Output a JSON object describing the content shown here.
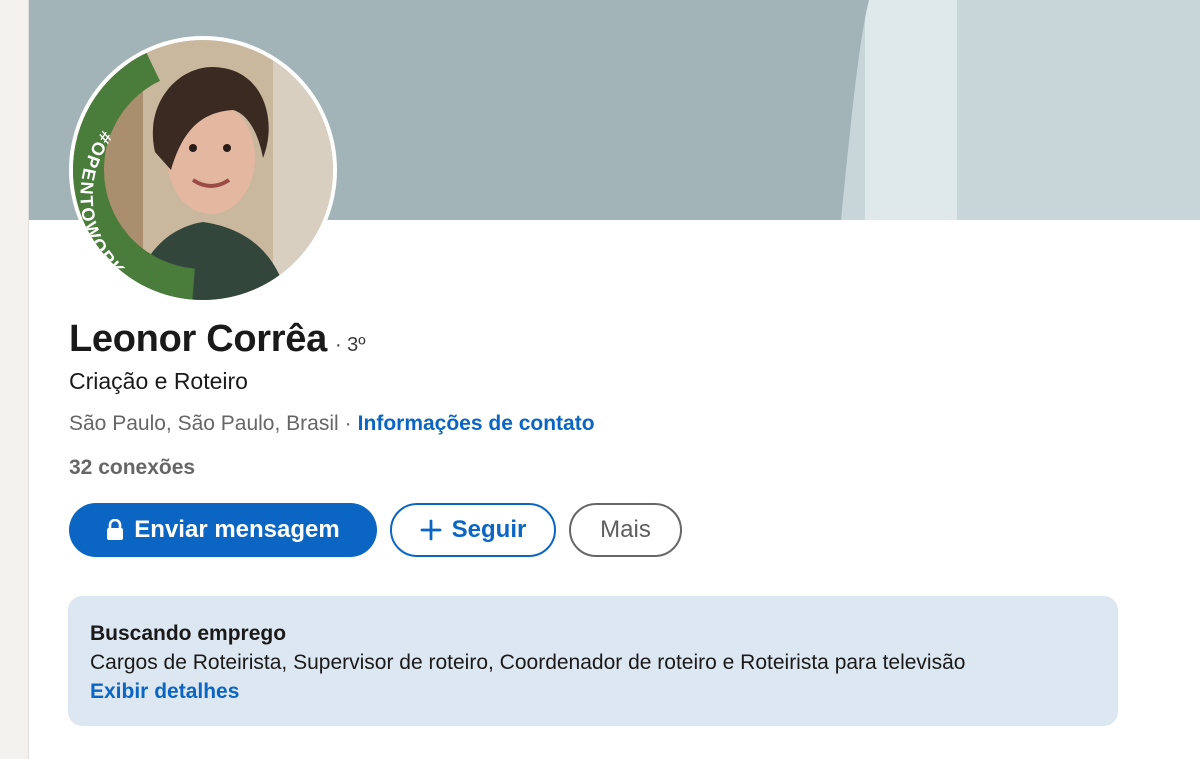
{
  "profile": {
    "name": "Leonor Corrêa",
    "degree": "· 3º",
    "headline": "Criação e Roteiro",
    "location": "São Paulo, São Paulo, Brasil",
    "separator": "·",
    "contact_link": "Informações de contato",
    "connections": "32 conexões",
    "avatar_frame_text": "#OPENTOWORK"
  },
  "actions": {
    "message_label": "Enviar mensagem",
    "follow_label": "Seguir",
    "more_label": "Mais"
  },
  "open_to_work": {
    "title": "Buscando emprego",
    "roles": "Cargos de Roteirista, Supervisor de roteiro, Coordenador de roteiro e Roteirista para televisão",
    "details_link": "Exibir detalhes"
  },
  "colors": {
    "brand_blue": "#0a66c2",
    "open_to_work_green": "#4a7c3b",
    "banner_dark": "#a3b4b8",
    "banner_light": "#c8d6da",
    "banner_pale": "#dfe8eb",
    "card_bg": "#dde7f1"
  },
  "icons": {
    "message": "lock-icon",
    "follow": "plus-icon"
  }
}
